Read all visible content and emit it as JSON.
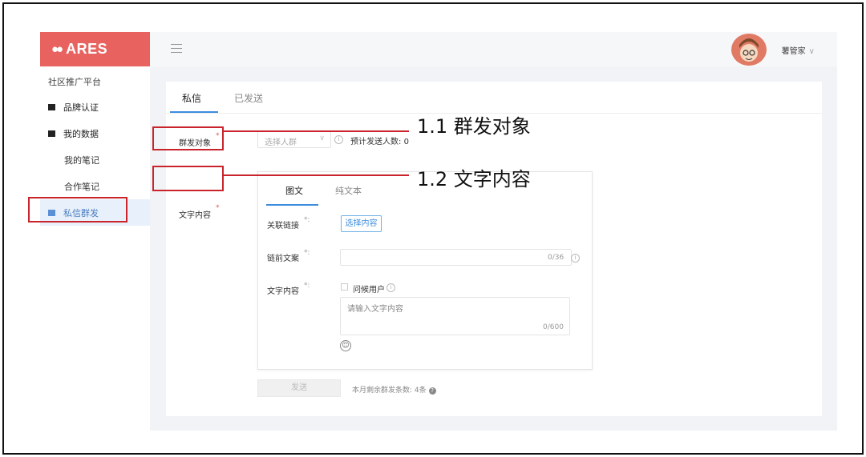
{
  "brand": {
    "logo_text": "ARES"
  },
  "sidebar": {
    "title": "社区推广平台",
    "items": [
      {
        "label": "品牌认证"
      },
      {
        "label": "我的数据"
      },
      {
        "label": "我的笔记"
      },
      {
        "label": "合作笔记"
      },
      {
        "label": "私信群发"
      }
    ]
  },
  "topbar": {
    "username": "薯管家"
  },
  "tabs": {
    "active": "私信",
    "inactive": "已发送"
  },
  "form": {
    "target_label": "群发对象",
    "select_placeholder": "选择人群",
    "estimate_label": "预计发送人数: ",
    "estimate_value": "0",
    "content_label": "文字内容"
  },
  "card": {
    "tab_active": "图文",
    "tab_inactive": "纯文本",
    "link_label": "关联链接",
    "choose_button": "选择内容",
    "pre_label": "链前文案",
    "pre_counter": "0/36",
    "text_label": "文字内容",
    "greet_label": "问候用户",
    "text_placeholder": "请输入文字内容",
    "text_counter": "0/600",
    "req_mark": "*:"
  },
  "footer": {
    "send_label": "发送",
    "quota_text": "本月剩余群发条数: 4条"
  },
  "annotations": {
    "a1": "1.1 群发对象",
    "a2": "1.2 文字内容"
  },
  "colors": {
    "brand": "#e8635f",
    "accent": "#3c8dde",
    "annotation": "#c9242b"
  }
}
